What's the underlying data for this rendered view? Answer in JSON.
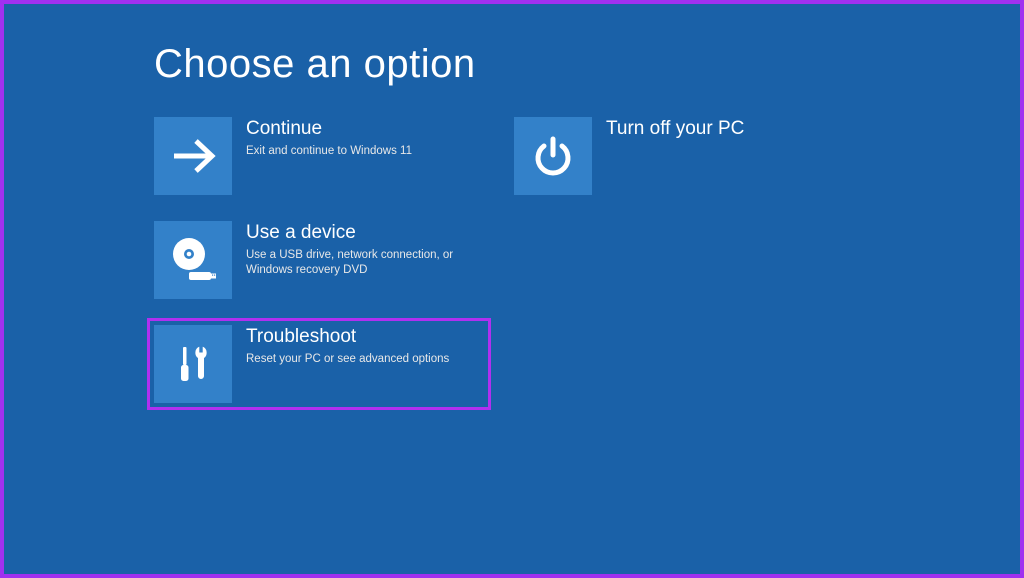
{
  "page": {
    "title": "Choose an option"
  },
  "tiles": {
    "continue": {
      "title": "Continue",
      "desc": "Exit and continue to Windows 11"
    },
    "useDevice": {
      "title": "Use a device",
      "desc": "Use a USB drive, network connection, or Windows recovery DVD"
    },
    "troubleshoot": {
      "title": "Troubleshoot",
      "desc": "Reset your PC or see advanced options"
    },
    "turnOff": {
      "title": "Turn off your PC",
      "desc": ""
    }
  }
}
